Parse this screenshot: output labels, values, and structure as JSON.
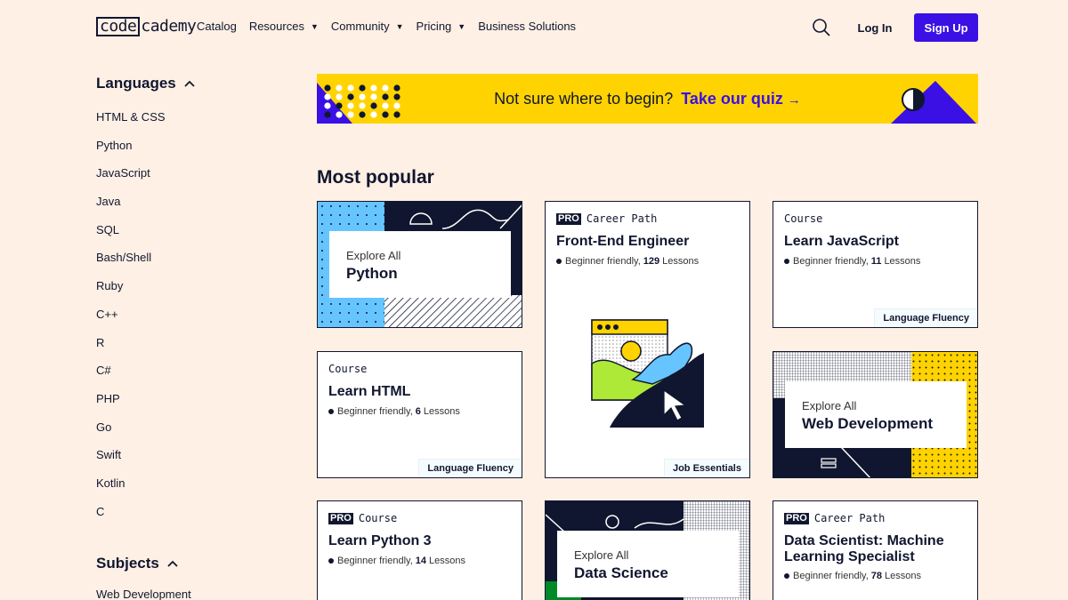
{
  "header": {
    "logo_part1": "code",
    "logo_part2": "cademy",
    "nav": [
      {
        "label": "Catalog",
        "caret": false
      },
      {
        "label": "Resources",
        "caret": true
      },
      {
        "label": "Community",
        "caret": true
      },
      {
        "label": "Pricing",
        "caret": true
      },
      {
        "label": "Business Solutions",
        "caret": false
      }
    ],
    "login": "Log In",
    "signup": "Sign Up"
  },
  "sidebar": {
    "languages_heading": "Languages",
    "languages": [
      "HTML & CSS",
      "Python",
      "JavaScript",
      "Java",
      "SQL",
      "Bash/Shell",
      "Ruby",
      "C++",
      "R",
      "C#",
      "PHP",
      "Go",
      "Swift",
      "Kotlin",
      "C"
    ],
    "subjects_heading": "Subjects",
    "subjects": [
      "Web Development"
    ]
  },
  "banner": {
    "text": "Not sure where to begin?",
    "link": "Take our quiz",
    "arrow": "→"
  },
  "section_title": "Most popular",
  "cards": {
    "python": {
      "explore": "Explore All",
      "title": "Python"
    },
    "frontend": {
      "pro": "PRO",
      "kind": "Career Path",
      "title": "Front-End Engineer",
      "level": "Beginner friendly,",
      "count": "129",
      "unit": "Lessons",
      "tag": "Job Essentials"
    },
    "js": {
      "kind": "Course",
      "title": "Learn JavaScript",
      "level": "Beginner friendly,",
      "count": "11",
      "unit": "Lessons",
      "tag": "Language Fluency"
    },
    "html": {
      "kind": "Course",
      "title": "Learn HTML",
      "level": "Beginner friendly,",
      "count": "6",
      "unit": "Lessons",
      "tag": "Language Fluency"
    },
    "webdev": {
      "explore": "Explore All",
      "title": "Web Development"
    },
    "python3": {
      "pro": "PRO",
      "kind": "Course",
      "title": "Learn Python 3",
      "level": "Beginner friendly,",
      "count": "14",
      "unit": "Lessons"
    },
    "datasci": {
      "explore": "Explore All",
      "title": "Data Science"
    },
    "dsml": {
      "pro": "PRO",
      "kind": "Career Path",
      "title": "Data Scientist: Machine Learning Specialist",
      "level": "Beginner friendly,",
      "count": "78",
      "unit": "Lessons"
    }
  },
  "colors": {
    "background": "#fff0e5",
    "navy": "#10162f",
    "purple": "#3a10e5",
    "yellow": "#ffd300",
    "sky": "#66c4ff",
    "green": "#aee938"
  },
  "icons": [
    "search-icon",
    "chevron-up-icon",
    "caret-down-icon",
    "arrow-right-icon",
    "cursor-pointer-icon"
  ]
}
